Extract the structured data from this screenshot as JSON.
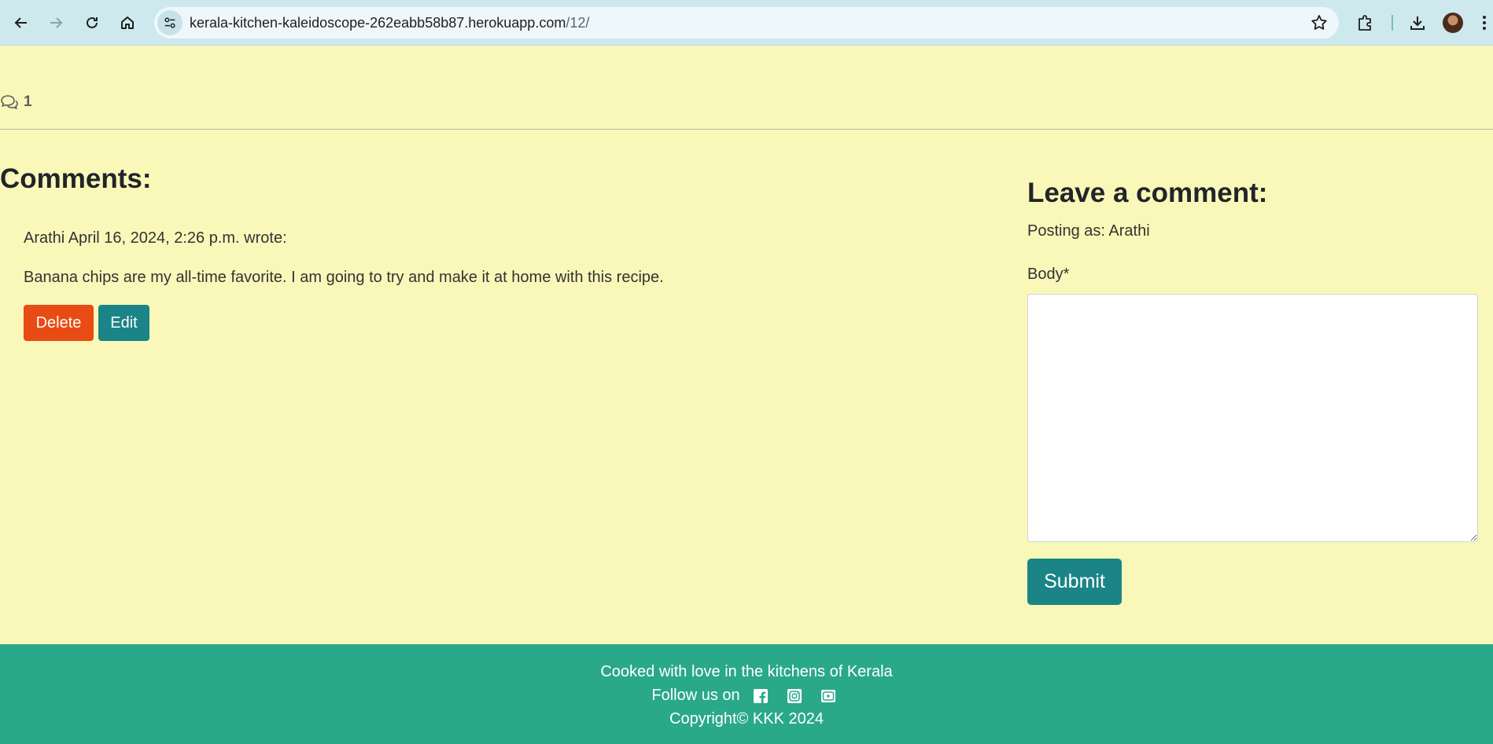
{
  "browser": {
    "url_host": "kerala-kitchen-kaleidoscope-262eabb58b87.herokuapp.com",
    "url_path": "/12/"
  },
  "post": {
    "comment_count": "1"
  },
  "comments": {
    "heading": "Comments:",
    "items": [
      {
        "meta": "Arathi April 16, 2024, 2:26 p.m. wrote:",
        "body": "Banana chips are my all-time favorite. I am going to try and make it at home with this recipe.",
        "delete_label": "Delete",
        "edit_label": "Edit"
      }
    ]
  },
  "comment_form": {
    "heading": "Leave a comment:",
    "posting_as": "Posting as: Arathi",
    "body_label": "Body*",
    "body_value": "",
    "submit_label": "Submit"
  },
  "footer": {
    "tagline": "Cooked with love in the kitchens of Kerala",
    "follow_label": "Follow us on",
    "social_icons": [
      "facebook-icon",
      "instagram-icon",
      "youtube-icon"
    ],
    "copyright": "Copyright© KKK 2024"
  },
  "colors": {
    "page_background": "#f9f8b9",
    "footer_background": "#2aa88a",
    "delete_button": "#e84b14",
    "primary_button": "#1b8486"
  }
}
